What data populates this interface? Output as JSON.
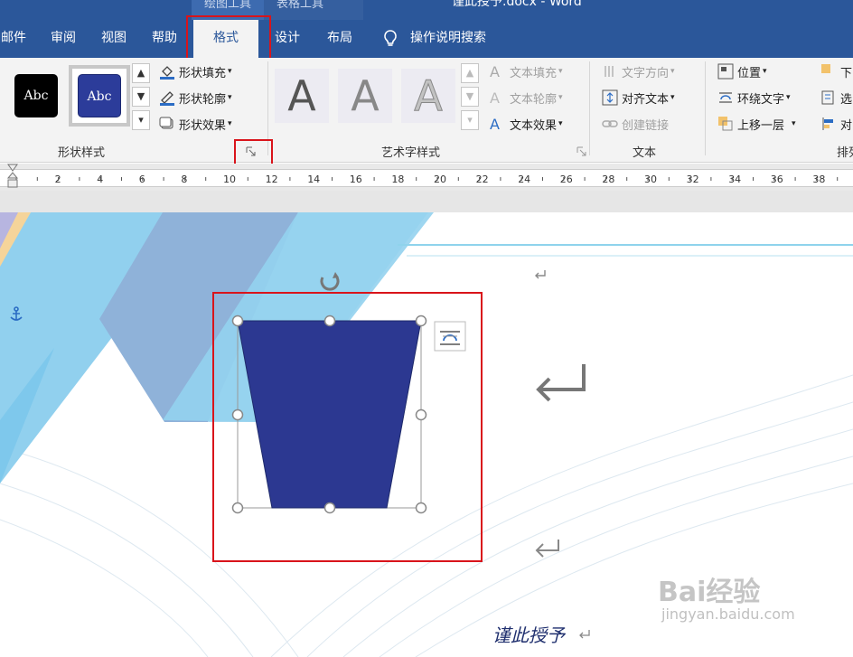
{
  "titlebar": {
    "context_tab_drawing": "绘图工具",
    "context_tab_table": "表格工具",
    "doc_title": "谨此授予.docx  -  Word"
  },
  "tabs": [
    {
      "label": "邮件"
    },
    {
      "label": "审阅"
    },
    {
      "label": "视图"
    },
    {
      "label": "帮助"
    },
    {
      "label": "格式"
    },
    {
      "label": "设计"
    },
    {
      "label": "布局"
    }
  ],
  "active_tab": "格式",
  "search_label": "操作说明搜索",
  "ribbon": {
    "shape_styles": {
      "group_label": "形状样式",
      "abc_black": "Abc",
      "abc_blue": "Abc",
      "fill": "形状填充",
      "outline": "形状轮廓",
      "effects": "形状效果"
    },
    "wordart": {
      "group_label": "艺术字样式",
      "letters": [
        "A",
        "A",
        "A"
      ],
      "text_fill": "文本填充",
      "text_outline": "文本轮廓",
      "text_effects": "文本效果"
    },
    "text": {
      "group_label": "文本",
      "direction": "文字方向",
      "align": "对齐文本",
      "link": "创建链接"
    },
    "arrange": {
      "group_label": "排列",
      "position": "位置",
      "wrap": "环绕文字",
      "bring_forward": "上移一层",
      "down": "下",
      "select": "选",
      "align": "对"
    }
  },
  "ruler_numbers": [
    "2",
    "4",
    "6",
    "8",
    "10",
    "12",
    "14",
    "16",
    "18",
    "20",
    "22",
    "24",
    "26",
    "28",
    "30",
    "32",
    "34",
    "36",
    "38"
  ],
  "document": {
    "body_text": "谨此授予",
    "shape_fill": "#2c3891",
    "watermark": "Bai经验",
    "watermark_sub": "jingyan.baidu.com"
  },
  "colors": {
    "ribbon_blue": "#2b579a",
    "highlight_red": "#d9141b",
    "light_blue": "#7ec8ec"
  }
}
